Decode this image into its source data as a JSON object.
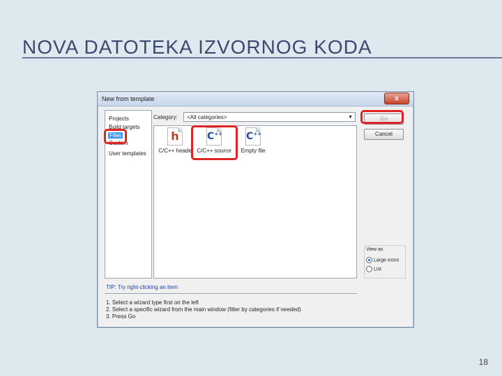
{
  "slide": {
    "title": "NOVA DATOTEKA IZVORNOG KODA",
    "page_number": "18"
  },
  "dialog": {
    "title": "New from template",
    "close_glyph": "x",
    "categories": [
      "Projects",
      "Build targets",
      "Files",
      "Custom",
      "User templates"
    ],
    "selected_category": "Files",
    "category_label": "Category:",
    "category_value": "<All categories>",
    "templates": [
      {
        "label": "C/C++ heade",
        "icon": "header-file-icon"
      },
      {
        "label": "C/C++ source",
        "icon": "cpp-source-file-icon"
      },
      {
        "label": "Empty file",
        "icon": "empty-file-icon"
      }
    ],
    "go_label": "Go",
    "cancel_label": "Cancel",
    "view_as": {
      "title": "View as",
      "large_icons": "Large icons",
      "list": "List",
      "selected": "Large icons"
    },
    "tip": "TIP: Try right-clicking an item",
    "steps": [
      "1. Select a wizard type first on the left",
      "2. Select a specific wizard from the main window (filter by categories if needed)",
      "3. Press Go"
    ]
  },
  "colors": {
    "highlight": "#e02424",
    "selection": "#3399ff",
    "title_text": "#3c4a6e"
  }
}
